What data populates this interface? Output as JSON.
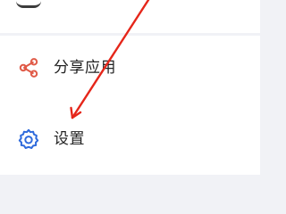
{
  "menu": {
    "items": [
      {
        "label": "分享应用",
        "icon": "share-icon",
        "icon_color": "#e05a47"
      },
      {
        "label": "设置",
        "icon": "gear-icon",
        "icon_color": "#2f6bdc"
      }
    ]
  },
  "annotation": {
    "arrow_color": "#e5261a"
  }
}
